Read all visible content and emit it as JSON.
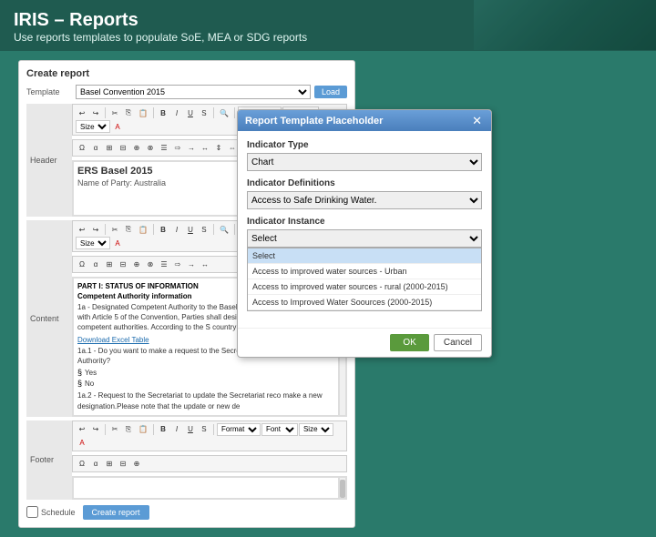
{
  "header": {
    "title": "IRIS – Reports",
    "subtitle": "Use reports templates to populate SoE, MEA or SDG reports"
  },
  "panel": {
    "title": "Create report",
    "template_label": "Template",
    "template_value": "Basel Convention 2015",
    "load_button": "Load",
    "header_label": "Header",
    "content_label": "Content",
    "footer_label": "Footer",
    "editor_title": "ERS Basel 2015",
    "editor_subtitle": "Name of Party: Australia",
    "content_part": "PART I: STATUS OF INFORMATION",
    "content_section": "Competent Authority information",
    "content_1a": "1a - Designated Competent Authority to the Basel Convention. In accordance with Article 5 of the Convention, Parties shall designate establish one or more competent authorities. According to the S country is(are):",
    "content_link": "Download Excel Table",
    "content_1a1": "1a.1 - Do you want to make a request to the Secretariat to upd Competent Authority?",
    "content_yes": "Yes",
    "content_no": "No",
    "content_1a2": "1a.2 - Request to the Secretariat to update the Secretariat reco make a new designation.Please note that the update or new de",
    "schedule_label": "Schedule",
    "create_button": "Create report"
  },
  "modal": {
    "title": "Report Template Placeholder",
    "indicator_type_label": "Indicator Type",
    "indicator_type_value": "Chart",
    "indicator_definitions_label": "Indicator Definitions",
    "indicator_definitions_value": "Access to Safe Drinking Water.",
    "indicator_instance_label": "Indicator Instance",
    "select_placeholder": "Select",
    "dropdown_items": [
      "Select",
      "Access to improved water sources - Urban",
      "Access to improved water sources - rural (2000-2015)",
      "Access to Improved Water Soources (2000-2015)"
    ],
    "ok_button": "OK",
    "cancel_button": "Cancel"
  },
  "toolbar": {
    "buttons": [
      "↩",
      "↪",
      "✂",
      "⎘",
      "📋",
      "B",
      "I",
      "U",
      "S",
      "X₂",
      "X²",
      "🔍",
      "⤢",
      "✎",
      "≡",
      "≡",
      "≡",
      "≡",
      "⬛",
      "⬛",
      "⬛",
      "≡",
      "≡",
      "⇤",
      "⇥",
      "↑",
      "↓",
      "♦",
      "↕",
      "⊞",
      "∑",
      "⊡"
    ],
    "format_label": "Format",
    "font_label": "Font",
    "size_label": "Size"
  }
}
